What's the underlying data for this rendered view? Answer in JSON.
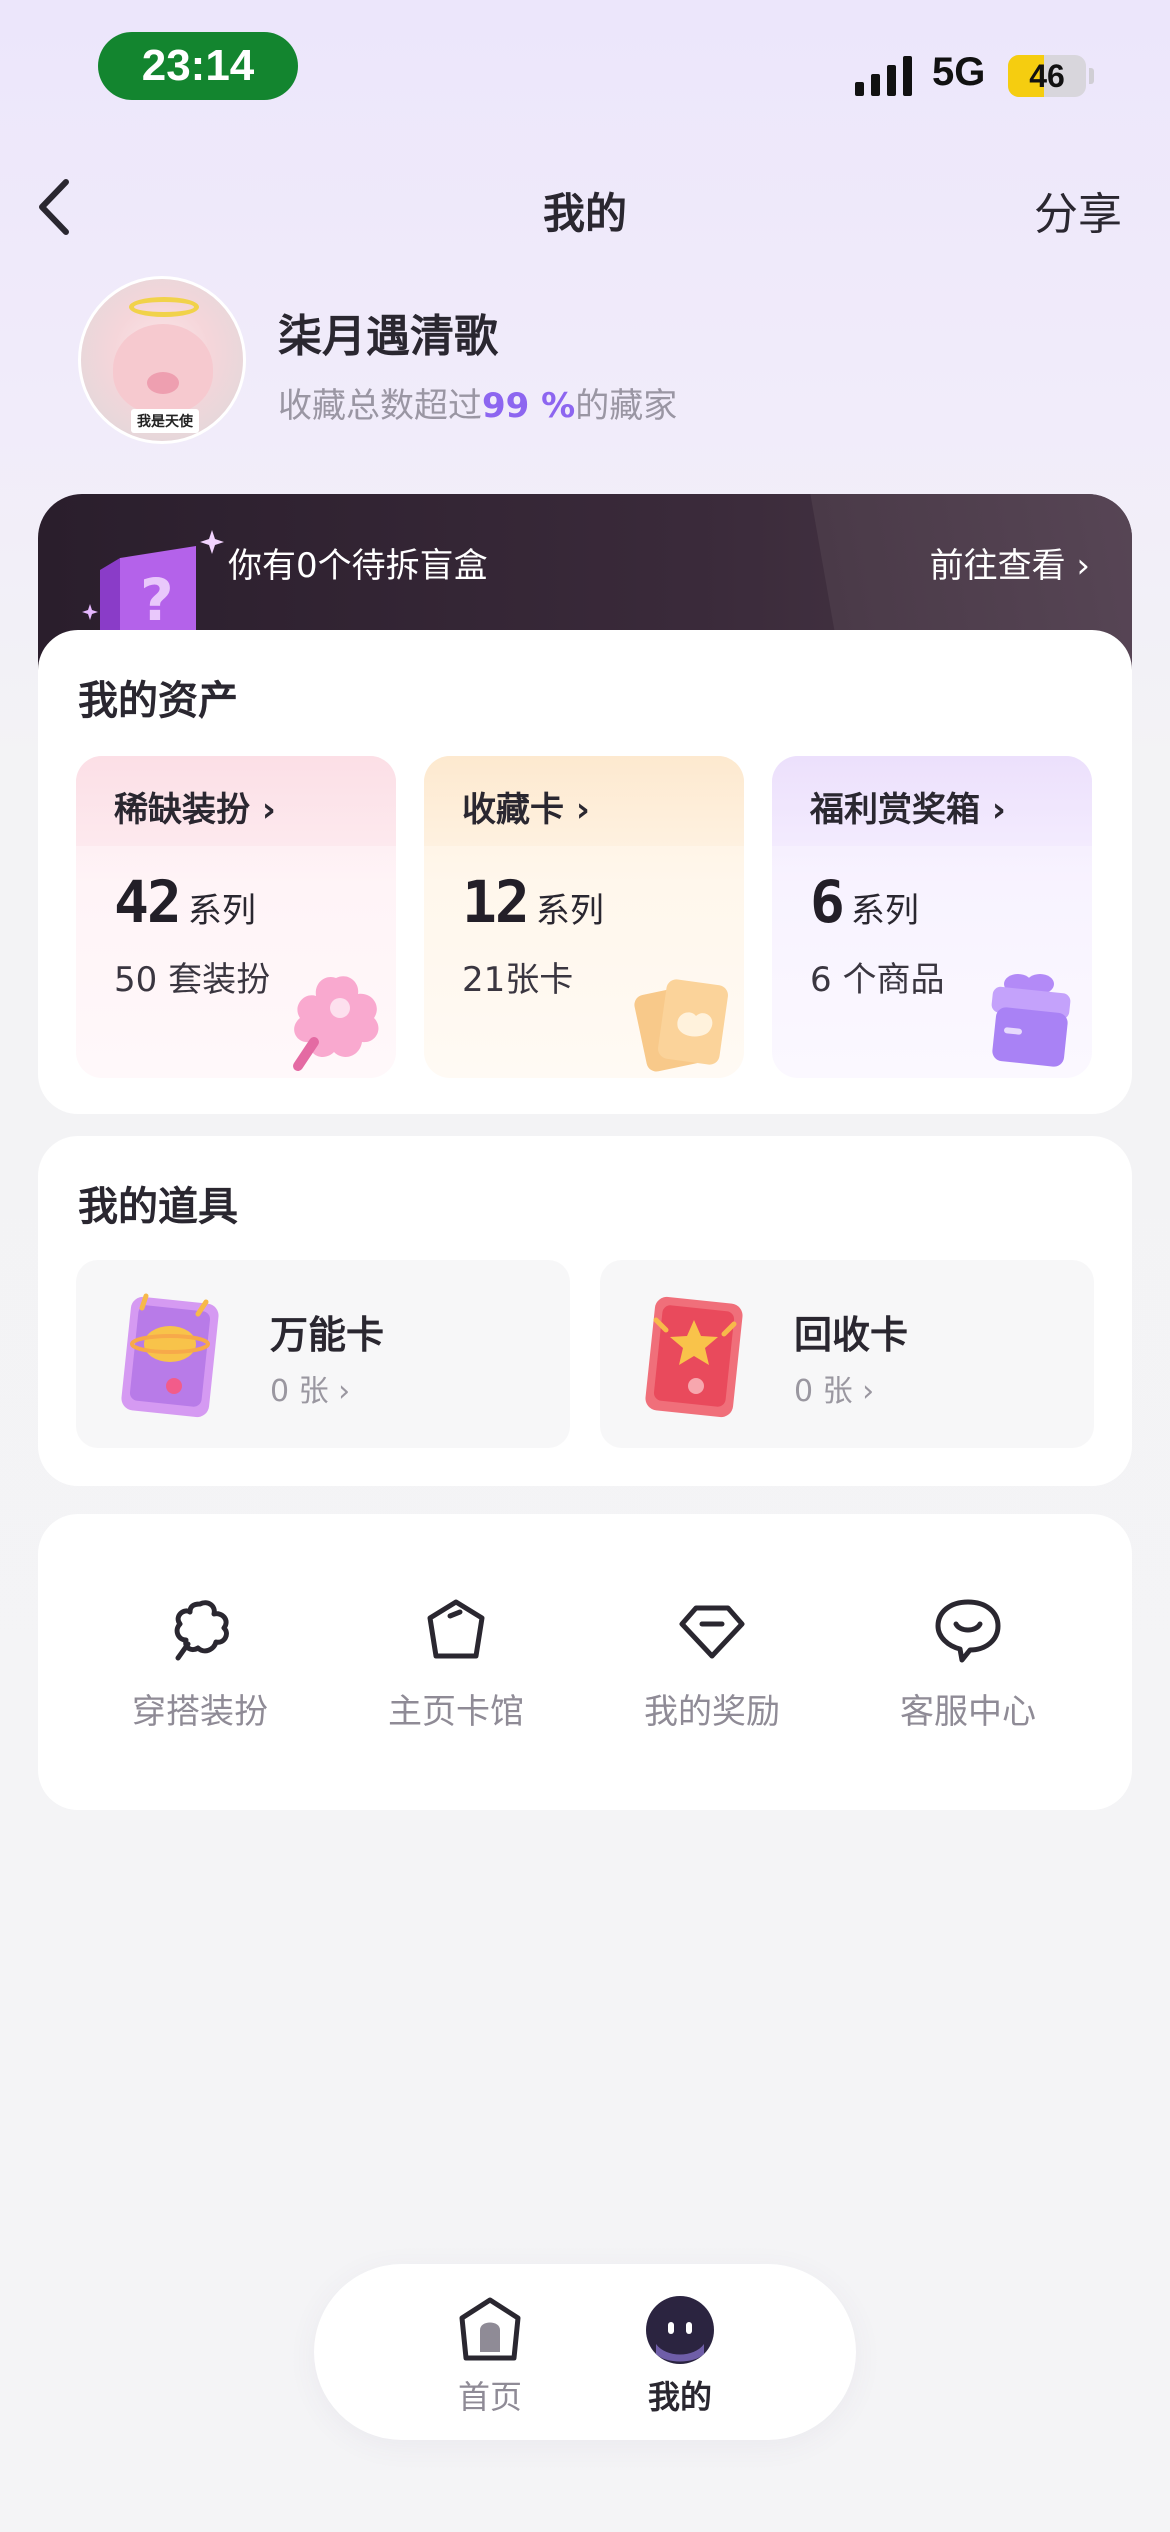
{
  "status_bar": {
    "time": "23:14",
    "network": "5G",
    "battery": "46",
    "battery_level": 0.46,
    "colors": {
      "time_pill": "#13852f",
      "battery_fill": "#f5cd10"
    }
  },
  "nav": {
    "back_icon": "chevron-left-icon",
    "title": "我的",
    "share": "分享"
  },
  "profile": {
    "avatar_caption": "我是天使",
    "name": "柒月遇清歌",
    "sub_prefix": "收藏总数超过",
    "sub_percent": "99 %",
    "sub_suffix": "的藏家",
    "accent": "#8d66f0"
  },
  "banner": {
    "icon": "mystery-box-icon",
    "text": "你有0个待拆盲盒",
    "link": "前往查看 ›"
  },
  "assets": {
    "title": "我的资产",
    "tiles": [
      {
        "label": "稀缺装扮 ›",
        "count": "42",
        "unit": "系列",
        "sub": "50 套装扮",
        "icon": "costume-icon"
      },
      {
        "label": "收藏卡 ›",
        "count": "12",
        "unit": "系列",
        "sub": "21张卡",
        "icon": "collection-card-icon"
      },
      {
        "label": "福利赏奖箱 ›",
        "count": "6",
        "unit": "系列",
        "sub": "6 个商品",
        "icon": "gift-box-icon"
      }
    ]
  },
  "props": {
    "title": "我的道具",
    "items": [
      {
        "name": "万能卡",
        "count": "0 张 ›",
        "icon": "universal-card-icon"
      },
      {
        "name": "回收卡",
        "count": "0 张 ›",
        "icon": "recycle-card-icon"
      }
    ]
  },
  "menu": {
    "items": [
      {
        "label": "穿搭装扮",
        "icon": "outfit-icon"
      },
      {
        "label": "主页卡馆",
        "icon": "card-hall-icon"
      },
      {
        "label": "我的奖励",
        "icon": "reward-gem-icon"
      },
      {
        "label": "客服中心",
        "icon": "customer-service-icon"
      }
    ]
  },
  "tabbar": {
    "items": [
      {
        "label": "首页",
        "icon": "home-icon"
      },
      {
        "label": "我的",
        "icon": "profile-face-icon",
        "active": true
      }
    ]
  }
}
